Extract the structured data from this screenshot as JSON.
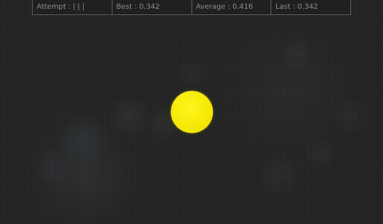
{
  "hud": {
    "attempt": "Attempt : | | |",
    "best": "Best : 0.342",
    "average": "Average : 0.416",
    "last": "Last : 0.342"
  },
  "target": {
    "icon": "yellow-circle-target",
    "color": "#f2e600"
  },
  "colors": {
    "background": "#292929",
    "hud_text": "#8c8c8c",
    "hud_border": "#5a5a5a"
  }
}
